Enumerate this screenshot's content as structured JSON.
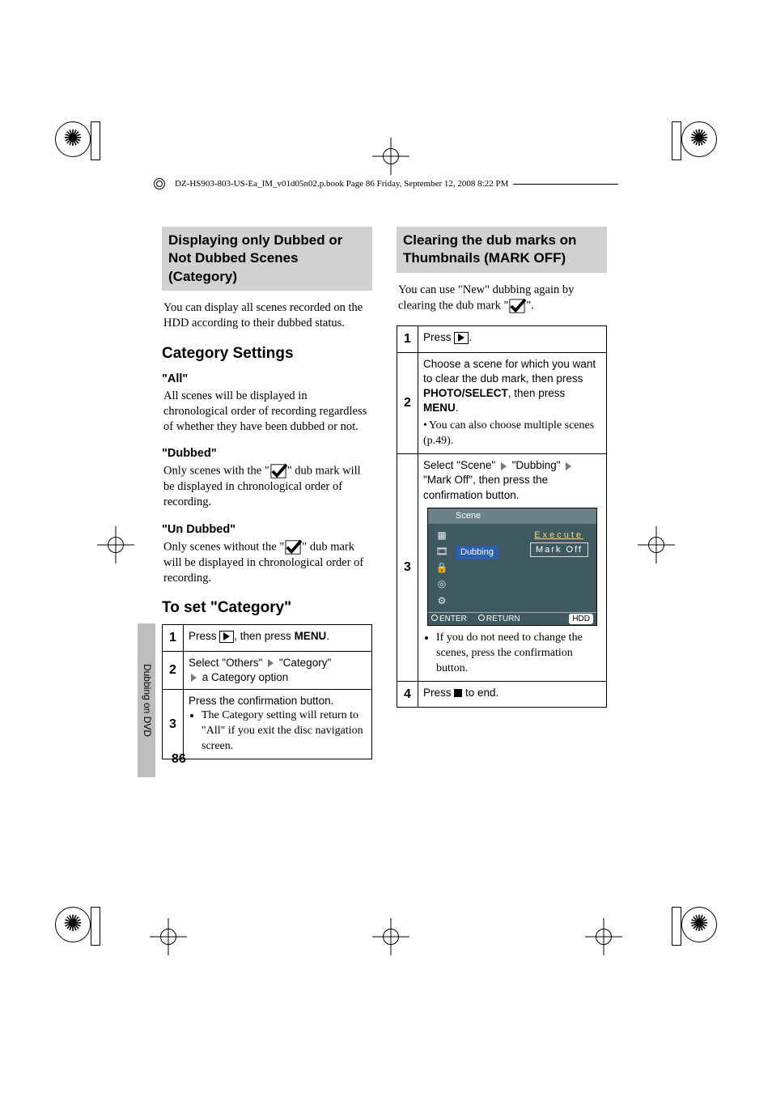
{
  "header": {
    "crop_text": "DZ-HS903-803-US-Ea_IM_v01d05n02.p.book  Page 86  Friday, September 12, 2008  8:22 PM"
  },
  "sidetab": "Dubbing on DVD",
  "page_number": "86",
  "left": {
    "sec_title": "Displaying only Dubbed or Not Dubbed Scenes (Category)",
    "intro": "You can display all scenes recorded on the HDD according to their dubbed status.",
    "h2a": "Category Settings",
    "all_h": "\"All\"",
    "all_p": "All scenes will be displayed in chronological order of recording regardless of whether they have been dubbed or not.",
    "dub_h": "\"Dubbed\"",
    "dub_p_a": "Only scenes with the \"",
    "dub_p_b": "\" dub mark will be displayed in chronological order of recording.",
    "und_h": "\"Un Dubbed\"",
    "und_p_a": "Only scenes without the \"",
    "und_p_b": "\" dub mark will be displayed in chronological order of recording.",
    "h2b": "To set \"Category\"",
    "steps": {
      "s1a": "Press ",
      "s1b": ", then press ",
      "s1menu": "MENU",
      "s1c": ".",
      "s2a": "Select \"Others\" ",
      "s2b": " \"Category\" ",
      "s2c": " a Category option",
      "s3a": "Press the confirmation button.",
      "s3b": "The Category setting will return to \"All\" if you exit the disc navigation screen."
    }
  },
  "right": {
    "sec_title": "Clearing the dub marks on Thumbnails (MARK OFF)",
    "intro_a": "You can use \"New\" dubbing again by clearing the dub mark \"",
    "intro_b": "\".",
    "steps": {
      "s1a": "Press ",
      "s1b": ".",
      "s2a": "Choose a scene for which you want to clear the dub mark, then press ",
      "s2photo": "PHOTO/SELECT",
      "s2b": ", then press ",
      "s2menu": "MENU",
      "s2c": ".",
      "s2note": "You can also choose multiple scenes (p.49).",
      "s3a": "Select \"Scene\" ",
      "s3b": " \"Dubbing\" ",
      "s3c": " \"Mark Off\", then press the confirmation button.",
      "s3note": "If you do not need to change the scenes, press the confirmation button.",
      "s4a": "Press ",
      "s4b": " to end."
    },
    "osd": {
      "top": "Scene",
      "execute": "Execute",
      "markoff": "Mark Off",
      "dubbing": "Dubbing",
      "enter": "ENTER",
      "return": "RETURN",
      "hdd": "HDD"
    }
  }
}
